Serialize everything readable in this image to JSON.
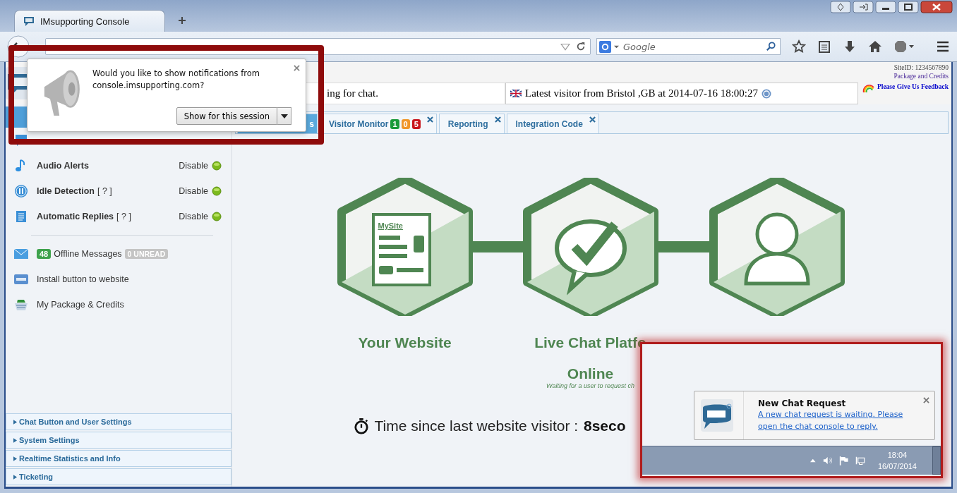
{
  "browser": {
    "tab_title": "IMsupporting Console",
    "search_placeholder": "Google"
  },
  "notification_prompt": {
    "message": "Would you like to show notifications from console.imsupporting.com?",
    "button": "Show for this session"
  },
  "header": {
    "status_text": "ing for chat.",
    "latest_visitor": "Latest visitor from Bristol ,GB at 2014-07-16 18:00:27",
    "site_id": "SiteID: 1234567890",
    "package_link": "Package and Credits",
    "feedback_link": "Please Give Us Feedback"
  },
  "sidebar": {
    "settings": [
      {
        "kind": "chat"
      },
      {
        "kind": "note",
        "label": "Audio Alerts",
        "value": "Disable"
      },
      {
        "kind": "pause",
        "label": "Idle Detection",
        "hint": "[ ? ]",
        "value": "Disable"
      },
      {
        "kind": "scroll",
        "label": "Automatic Replies",
        "hint": "[ ? ]",
        "value": "Disable"
      }
    ],
    "links": [
      {
        "kind": "mail",
        "count": "48",
        "label": "Offline Messages",
        "badge": "0 UNREAD"
      },
      {
        "kind": "html",
        "label": "Install button to website"
      },
      {
        "kind": "package",
        "label": "My Package & Credits"
      }
    ],
    "sections": [
      "Chat Button and User Settings",
      "System Settings",
      "Realtime Statistics and Info",
      "Ticketing"
    ]
  },
  "tabs": [
    {
      "label": "s",
      "selected": true,
      "closable": false
    },
    {
      "label": "Visitor Monitor",
      "selected": false,
      "closable": true,
      "counts": [
        {
          "value": "1",
          "color": "#1a9a3a"
        },
        {
          "value": "0",
          "color": "#f0962a"
        },
        {
          "value": "5",
          "color": "#c8161d"
        }
      ]
    },
    {
      "label": "Reporting",
      "selected": false,
      "closable": true
    },
    {
      "label": "Integration Code",
      "selected": false,
      "closable": true
    }
  ],
  "diagram": {
    "site_label": "MySite",
    "nodes": [
      {
        "kind": "website",
        "label": "Your Website"
      },
      {
        "kind": "chat",
        "label": "Live Chat Platfo"
      },
      {
        "kind": "user"
      }
    ],
    "status": "Online",
    "status_note": "Waiting for a user to request ch",
    "timer_label": "Time since last website visitor : ",
    "timer_value": "8seco"
  },
  "toast": {
    "title": "New Chat Request",
    "message": "A new chat request is waiting. Please open the chat console to reply."
  },
  "taskbar": {
    "time": "18:04",
    "date": "16/07/2014"
  }
}
